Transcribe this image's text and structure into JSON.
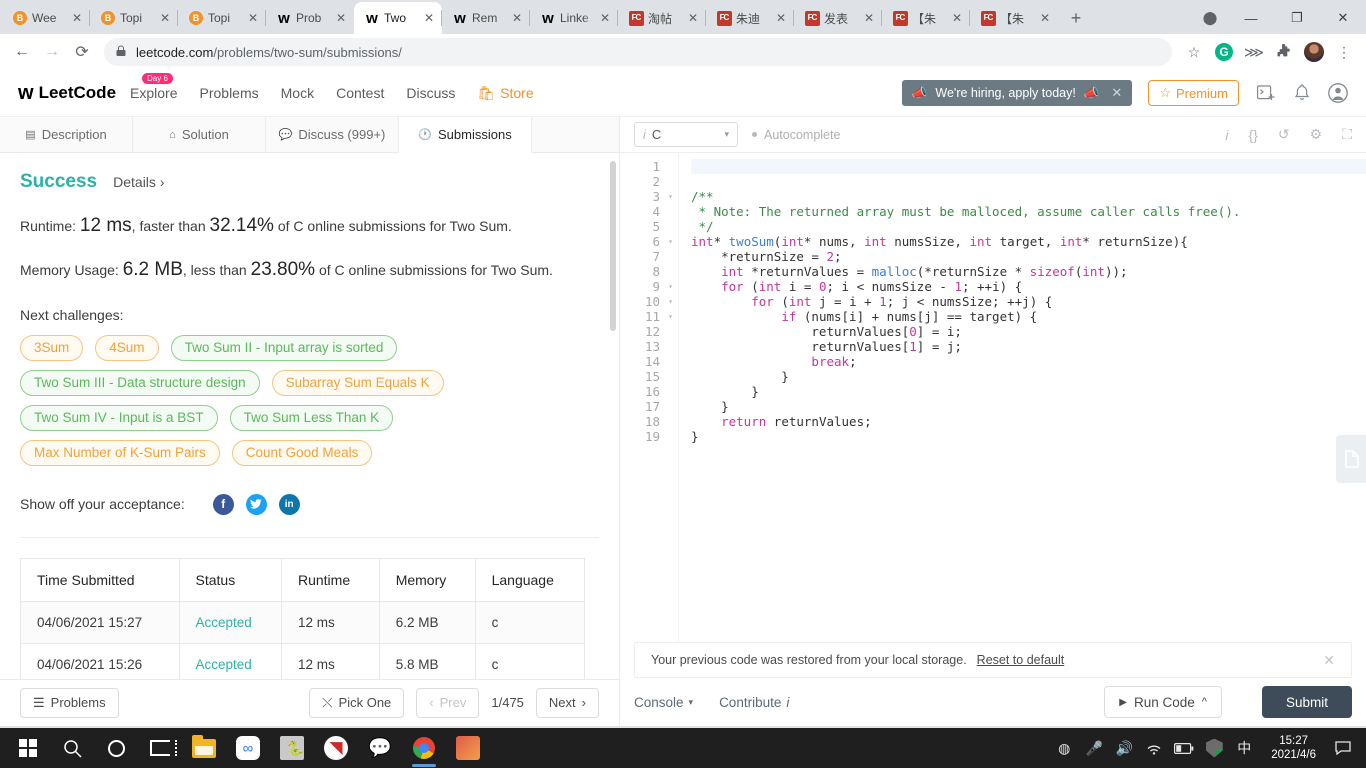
{
  "browser": {
    "tabs": [
      {
        "label": "Wee",
        "favicon": "brave-icon",
        "active": false
      },
      {
        "label": "Topi",
        "favicon": "brave-icon",
        "active": false
      },
      {
        "label": "Topi",
        "favicon": "brave-icon",
        "active": false
      },
      {
        "label": "Prob",
        "favicon": "leetcode-icon",
        "active": false
      },
      {
        "label": "Two",
        "favicon": "leetcode-icon",
        "active": true
      },
      {
        "label": "Rem",
        "favicon": "leetcode-icon",
        "active": false
      },
      {
        "label": "Linke",
        "favicon": "leetcode-icon",
        "active": false
      },
      {
        "label": "淘帖",
        "favicon": "fc-icon",
        "active": false
      },
      {
        "label": "朱迪",
        "favicon": "fc-icon",
        "active": false
      },
      {
        "label": "发表",
        "favicon": "fc-icon",
        "active": false
      },
      {
        "label": "【朱",
        "favicon": "fc-icon",
        "active": false
      },
      {
        "label": "【朱",
        "favicon": "fc-icon",
        "active": false
      }
    ],
    "new_tab_label": "+",
    "close_label": "✕",
    "window_minimize": "—",
    "window_maximize": "❐",
    "window_close": "✕",
    "back_label": "←",
    "forward_label": "→",
    "reload_label": "⟳",
    "url_host": "leetcode.com",
    "url_path": "/problems/two-sum/submissions/",
    "lock_label": "🔒",
    "bookmark_label": "☆",
    "grammarly_label": "G",
    "extensions_label": "⋙",
    "puzzle_label": "🧩",
    "menu_label": "⋮"
  },
  "lc_header": {
    "brand": "LeetCode",
    "nav": [
      {
        "label": "Explore",
        "badge": "Day 6"
      },
      {
        "label": "Problems",
        "badge": ""
      },
      {
        "label": "Mock",
        "badge": ""
      },
      {
        "label": "Contest",
        "badge": ""
      },
      {
        "label": "Discuss",
        "badge": ""
      }
    ],
    "store_label": "Store",
    "hiring_banner": "We're hiring, apply today!",
    "hiring_close": "✕",
    "premium_label": "Premium",
    "terminal_icon": "terminal-add-icon",
    "bell_icon": "bell-icon",
    "user_icon": "user-avatar-icon"
  },
  "problem_tabs": [
    {
      "label": "Description",
      "icon": "description-icon",
      "active": false
    },
    {
      "label": "Solution",
      "icon": "flask-icon",
      "active": false
    },
    {
      "label": "Discuss (999+)",
      "icon": "discuss-icon",
      "active": false
    },
    {
      "label": "Submissions",
      "icon": "clock-icon",
      "active": true
    }
  ],
  "result": {
    "status": "Success",
    "details_label": "Details",
    "details_chevron": "›",
    "runtime_prefix": "Runtime:",
    "runtime_value": "12 ms",
    "runtime_mid": ", faster than",
    "runtime_percent": "32.14%",
    "runtime_suffix": "of C online submissions for Two Sum.",
    "memory_prefix": "Memory Usage:",
    "memory_value": "6.2 MB",
    "memory_mid": ", less than",
    "memory_percent": "23.80%",
    "memory_suffix": "of C online submissions for Two Sum."
  },
  "next_challenges": {
    "title": "Next challenges:",
    "pills": [
      {
        "label": "3Sum",
        "difficulty": "med"
      },
      {
        "label": "4Sum",
        "difficulty": "med"
      },
      {
        "label": "Two Sum II - Input array is sorted",
        "difficulty": "easy"
      },
      {
        "label": "Two Sum III - Data structure design",
        "difficulty": "easy"
      },
      {
        "label": "Subarray Sum Equals K",
        "difficulty": "med"
      },
      {
        "label": "Two Sum IV - Input is a BST",
        "difficulty": "easy"
      },
      {
        "label": "Two Sum Less Than K",
        "difficulty": "easy"
      },
      {
        "label": "Max Number of K-Sum Pairs",
        "difficulty": "med"
      },
      {
        "label": "Count Good Meals",
        "difficulty": "med"
      }
    ]
  },
  "share": {
    "label": "Show off your acceptance:",
    "facebook": "f",
    "twitter": "🐦",
    "linkedin": "in"
  },
  "submissions_table": {
    "columns": [
      "Time Submitted",
      "Status",
      "Runtime",
      "Memory",
      "Language"
    ],
    "rows": [
      [
        "04/06/2021 15:27",
        "Accepted",
        "12 ms",
        "6.2 MB",
        "c"
      ],
      [
        "04/06/2021 15:26",
        "Accepted",
        "12 ms",
        "5.8 MB",
        "c"
      ]
    ]
  },
  "left_footer": {
    "problems_label": "Problems",
    "problems_icon": "list-icon",
    "pick_one_label": "Pick One",
    "pick_one_icon": "shuffle-icon",
    "prev_label": "Prev",
    "prev_chevron": "‹",
    "page_indicator": "1/475",
    "next_label": "Next",
    "next_chevron": "›"
  },
  "editor_header": {
    "language": "C",
    "language_info_icon": "i",
    "caret": "▾",
    "autocomplete_label": "Autocomplete",
    "icons": [
      "info-icon",
      "format-braces-icon",
      "reset-icon",
      "settings-icon",
      "fullscreen-icon"
    ],
    "icon_glyphs": [
      "i",
      "{}",
      "↺",
      "⚙",
      "⛶"
    ]
  },
  "code": {
    "lines": [
      {
        "n": 1,
        "fold": false,
        "highlight": true,
        "html": ""
      },
      {
        "n": 2,
        "fold": false,
        "highlight": false,
        "html": ""
      },
      {
        "n": 3,
        "fold": true,
        "highlight": false,
        "html": "<span class='c-cmt'>/**</span>"
      },
      {
        "n": 4,
        "fold": false,
        "highlight": false,
        "html": "<span class='c-cmt'> * Note: The returned array must be malloced, assume caller calls free().</span>"
      },
      {
        "n": 5,
        "fold": false,
        "highlight": false,
        "html": "<span class='c-cmt'> */</span>"
      },
      {
        "n": 6,
        "fold": true,
        "highlight": false,
        "html": "<span class='c-kw'>int</span>* <span class='c-fn'>twoSum</span>(<span class='c-kw'>int</span>* nums, <span class='c-kw'>int</span> numsSize, <span class='c-kw'>int</span> target, <span class='c-kw'>int</span>* returnSize){"
      },
      {
        "n": 7,
        "fold": false,
        "highlight": false,
        "html": "    *returnSize = <span class='c-num'>2</span>;"
      },
      {
        "n": 8,
        "fold": false,
        "highlight": false,
        "html": "    <span class='c-kw'>int</span> *returnValues = <span class='c-fn'>malloc</span>(*returnSize * <span class='c-kw'>sizeof</span>(<span class='c-kw'>int</span>));"
      },
      {
        "n": 9,
        "fold": true,
        "highlight": false,
        "html": "    <span class='c-kw'>for</span> (<span class='c-kw'>int</span> i = <span class='c-num'>0</span>; i &lt; numsSize - <span class='c-num'>1</span>; ++i) {"
      },
      {
        "n": 10,
        "fold": true,
        "highlight": false,
        "html": "        <span class='c-kw'>for</span> (<span class='c-kw'>int</span> j = i + <span class='c-num'>1</span>; j &lt; numsSize; ++j) {"
      },
      {
        "n": 11,
        "fold": true,
        "highlight": false,
        "html": "            <span class='c-kw'>if</span> (nums[i] + nums[j] == target) {"
      },
      {
        "n": 12,
        "fold": false,
        "highlight": false,
        "html": "                returnValues[<span class='c-num'>0</span>] = i;"
      },
      {
        "n": 13,
        "fold": false,
        "highlight": false,
        "html": "                returnValues[<span class='c-num'>1</span>] = j;"
      },
      {
        "n": 14,
        "fold": false,
        "highlight": false,
        "html": "                <span class='c-kw'>break</span>;"
      },
      {
        "n": 15,
        "fold": false,
        "highlight": false,
        "html": "            }"
      },
      {
        "n": 16,
        "fold": false,
        "highlight": false,
        "html": "        }"
      },
      {
        "n": 17,
        "fold": false,
        "highlight": false,
        "html": "    }"
      },
      {
        "n": 18,
        "fold": false,
        "highlight": false,
        "html": "    <span class='c-kw'>return</span> returnValues;"
      },
      {
        "n": 19,
        "fold": false,
        "highlight": false,
        "html": "}"
      }
    ]
  },
  "restore_notice": {
    "message": "Your previous code was restored from your local storage.",
    "action": "Reset to default",
    "close": "✕"
  },
  "editor_footer": {
    "console_label": "Console",
    "console_caret": "▾",
    "contribute_label": "Contribute",
    "contribute_icon": "i",
    "run_code_label": "Run Code",
    "run_play_icon": "▶",
    "run_caret": "^",
    "submit_label": "Submit"
  },
  "panel_tab_icon": "document-panel-icon",
  "taskbar": {
    "items": [
      "start-icon",
      "search-icon",
      "cortana-icon",
      "task-view-icon",
      "file-explorer-icon",
      "baidu-netdisk-icon",
      "python-idle-icon",
      "anaconda-icon",
      "wechat-icon",
      "chrome-icon",
      "photos-icon"
    ],
    "tray": [
      "battery-circle-icon",
      "microphone-icon",
      "volume-icon",
      "wifi-icon",
      "battery-icon",
      "security-icon",
      "ime-icon"
    ],
    "ime_label": "中",
    "time": "15:27",
    "date": "2021/4/6",
    "notification_icon": "notification-icon"
  },
  "colors": {
    "accent_green": "#2db3a6",
    "orange": "#f0932b",
    "easy_green": "#5cb85c",
    "medium_orange": "#f0a33a",
    "submit_dark": "#3e4c59"
  }
}
